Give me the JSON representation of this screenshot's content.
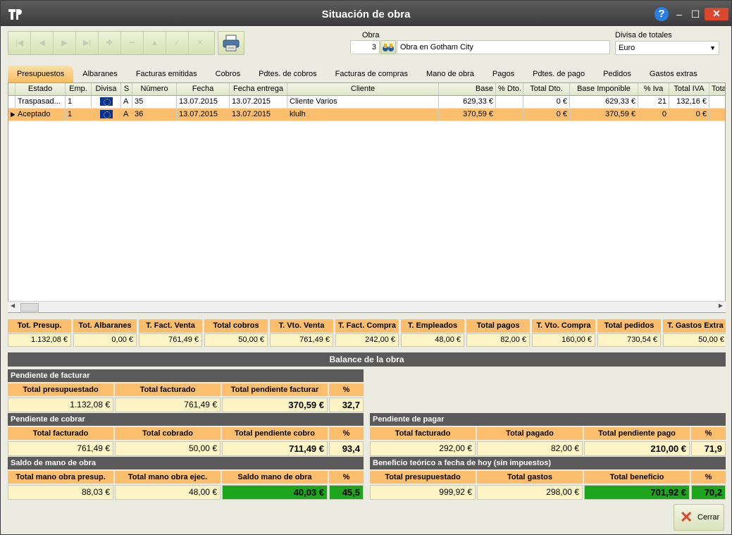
{
  "window": {
    "title": "Situación de obra"
  },
  "obra": {
    "label": "Obra",
    "number": "3",
    "name": "Obra en Gotham City"
  },
  "divisa": {
    "label": "Divisa de totales",
    "value": "Euro"
  },
  "tabs": [
    "Presupuestos",
    "Albaranes",
    "Facturas emitidas",
    "Cobros",
    "Pdtes. de cobros",
    "Facturas de compras",
    "Mano de obra",
    "Pagos",
    "Pdtes. de pago",
    "Pedidos",
    "Gastos extras"
  ],
  "grid": {
    "columns": [
      "Estado",
      "Emp.",
      "Divisa",
      "S",
      "Número",
      "Fecha",
      "Fecha entrega",
      "Cliente",
      "Base",
      "% Dto.",
      "Total Dto.",
      "Base Imponible",
      "% Iva",
      "Total IVA",
      "Tota"
    ],
    "rows": [
      {
        "estado": "Traspasad...",
        "emp": "1",
        "s": "A",
        "numero": "35",
        "fecha": "13.07.2015",
        "entrega": "13.07.2015",
        "cliente": "Cliente Varios",
        "base": "629,33 €",
        "dto": "",
        "total_dto": "0 €",
        "base_imp": "629,33 €",
        "iva": "21",
        "total_iva": "132,16 €",
        "tota": ""
      },
      {
        "estado": "Aceptado",
        "emp": "1",
        "s": "A",
        "numero": "36",
        "fecha": "13.07.2015",
        "entrega": "13.07.2015",
        "cliente": "klulh",
        "base": "370,59 €",
        "dto": "",
        "total_dto": "0 €",
        "base_imp": "370,59 €",
        "iva": "0",
        "total_iva": "0 €",
        "tota": ""
      }
    ]
  },
  "totals": [
    {
      "label": "Tot. Presup.",
      "value": "1.132,08 €"
    },
    {
      "label": "Tot. Albaranes",
      "value": "0,00 €"
    },
    {
      "label": "T. Fact. Venta",
      "value": "761,49 €"
    },
    {
      "label": "Total cobros",
      "value": "50,00 €"
    },
    {
      "label": "T. Vto. Venta",
      "value": "761,49 €"
    },
    {
      "label": "T. Fact. Compra",
      "value": "242,00 €"
    },
    {
      "label": "T. Empleados",
      "value": "48,00 €"
    },
    {
      "label": "Total pagos",
      "value": "82,00 €"
    },
    {
      "label": "T. Vto. Compra",
      "value": "160,00 €"
    },
    {
      "label": "Total pedidos",
      "value": "730,54 €"
    },
    {
      "label": "T. Gastos Extra",
      "value": "50,00 €"
    }
  ],
  "balance": {
    "title": "Balance de la obra",
    "pendiente_facturar": {
      "title": "Pendiente de facturar",
      "headers": [
        "Total presupuestado",
        "Total facturado",
        "Total pendiente facturar",
        "%"
      ],
      "values": [
        "1.132,08 €",
        "761,49 €",
        "370,59 €",
        "32,7"
      ]
    },
    "pendiente_cobrar": {
      "title": "Pendiente de cobrar",
      "headers": [
        "Total facturado",
        "Total cobrado",
        "Total pendiente cobro",
        "%"
      ],
      "values": [
        "761,49 €",
        "50,00 €",
        "711,49 €",
        "93,4"
      ]
    },
    "pendiente_pagar": {
      "title": "Pendiente de pagar",
      "headers": [
        "Total facturado",
        "Total pagado",
        "Total pendiente pago",
        "%"
      ],
      "values": [
        "292,00 €",
        "82,00 €",
        "210,00 €",
        "71,9"
      ]
    },
    "mano_obra": {
      "title": "Saldo de mano de obra",
      "headers": [
        "Total mano obra presup.",
        "Total mano obra ejec.",
        "Saldo mano de obra",
        "%"
      ],
      "values": [
        "88,03 €",
        "48,00 €",
        "40,03 €",
        "45,5"
      ]
    },
    "beneficio": {
      "title": "Beneficio teórico a fecha de hoy (sin impuestos)",
      "headers": [
        "Total presupuestado",
        "Total gastos",
        "Total beneficio",
        "%"
      ],
      "values": [
        "999,92 €",
        "298,00 €",
        "701,92 €",
        "70,2"
      ]
    }
  },
  "buttons": {
    "cerrar": "Cerrar"
  },
  "colors": {
    "accent": "#fbbe6c",
    "value_bg": "#fdf4c5",
    "positive": "#1ea51e",
    "title_bar": "#4a4a4a"
  }
}
